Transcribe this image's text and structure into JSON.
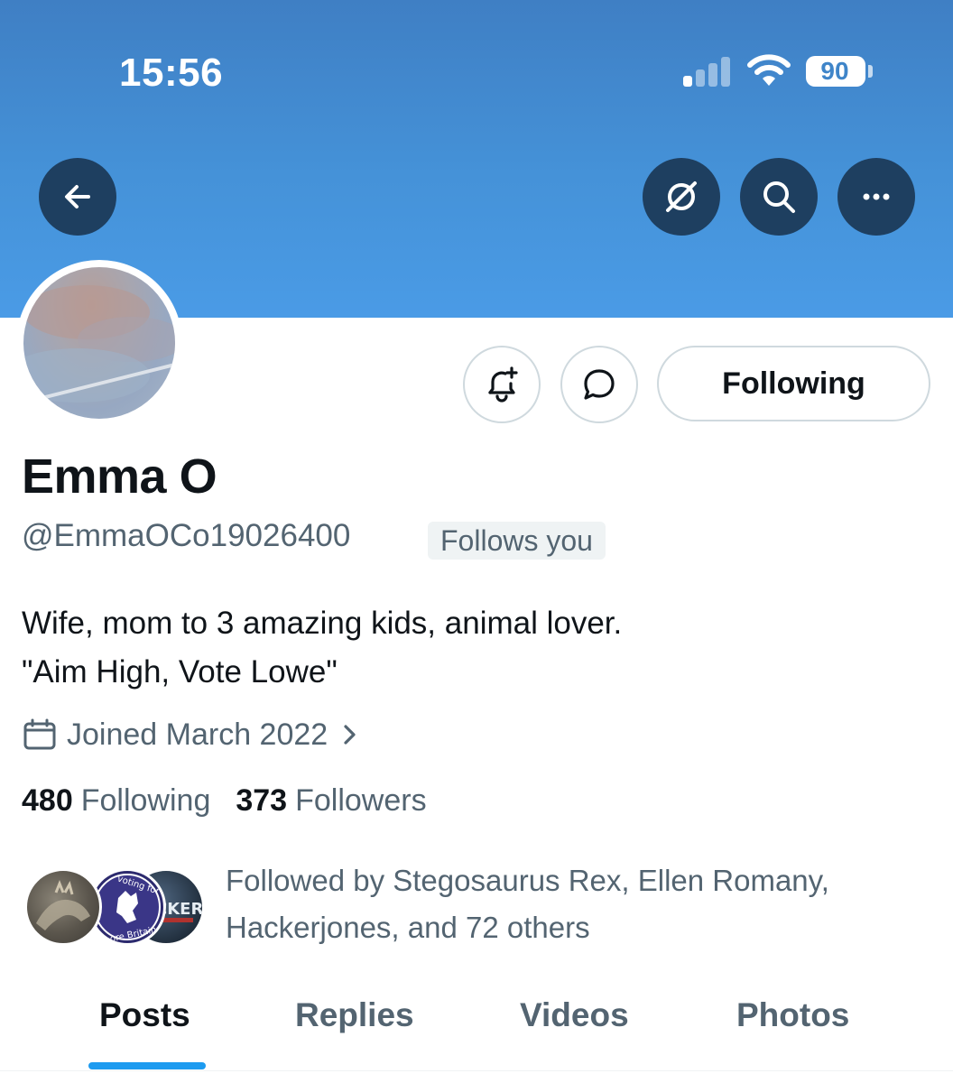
{
  "status_bar": {
    "time": "15:56",
    "battery": "90"
  },
  "header": {
    "icons": [
      "back-arrow-icon",
      "grok-icon",
      "search-icon",
      "more-icon"
    ]
  },
  "actions": {
    "notify_icon": "bell-plus-icon",
    "message_icon": "chat-bubble-icon",
    "following_label": "Following"
  },
  "profile": {
    "display_name": "Emma O",
    "handle": "@EmmaOCo19026400",
    "follows_you": "Follows you",
    "bio_line1": "Wife, mom to 3 amazing kids, animal lover.",
    "bio_line2": "\"Aim High, Vote Lowe\"",
    "joined": "Joined March 2022"
  },
  "stats": {
    "following_count": "480",
    "following_label": "Following",
    "followers_count": "373",
    "followers_label": "Followers"
  },
  "followed_by": {
    "line1": "Followed by Stegosaurus Rex, Ellen Romany,",
    "line2": "Hackerjones, and 72 others",
    "avatar2_text_top": "voting for",
    "avatar2_text_bottom": "ore Britain",
    "avatar3_text": "CKER"
  },
  "tabs": [
    {
      "label": "Posts",
      "active": true
    },
    {
      "label": "Replies",
      "active": false
    },
    {
      "label": "Videos",
      "active": false
    },
    {
      "label": "Photos",
      "active": false
    }
  ],
  "colors": {
    "header_top": "#3f7fc4",
    "header_bottom": "#4a9be6",
    "header_button": "#1e3f60",
    "accent": "#1d9bf0",
    "secondary_text": "#536471"
  }
}
